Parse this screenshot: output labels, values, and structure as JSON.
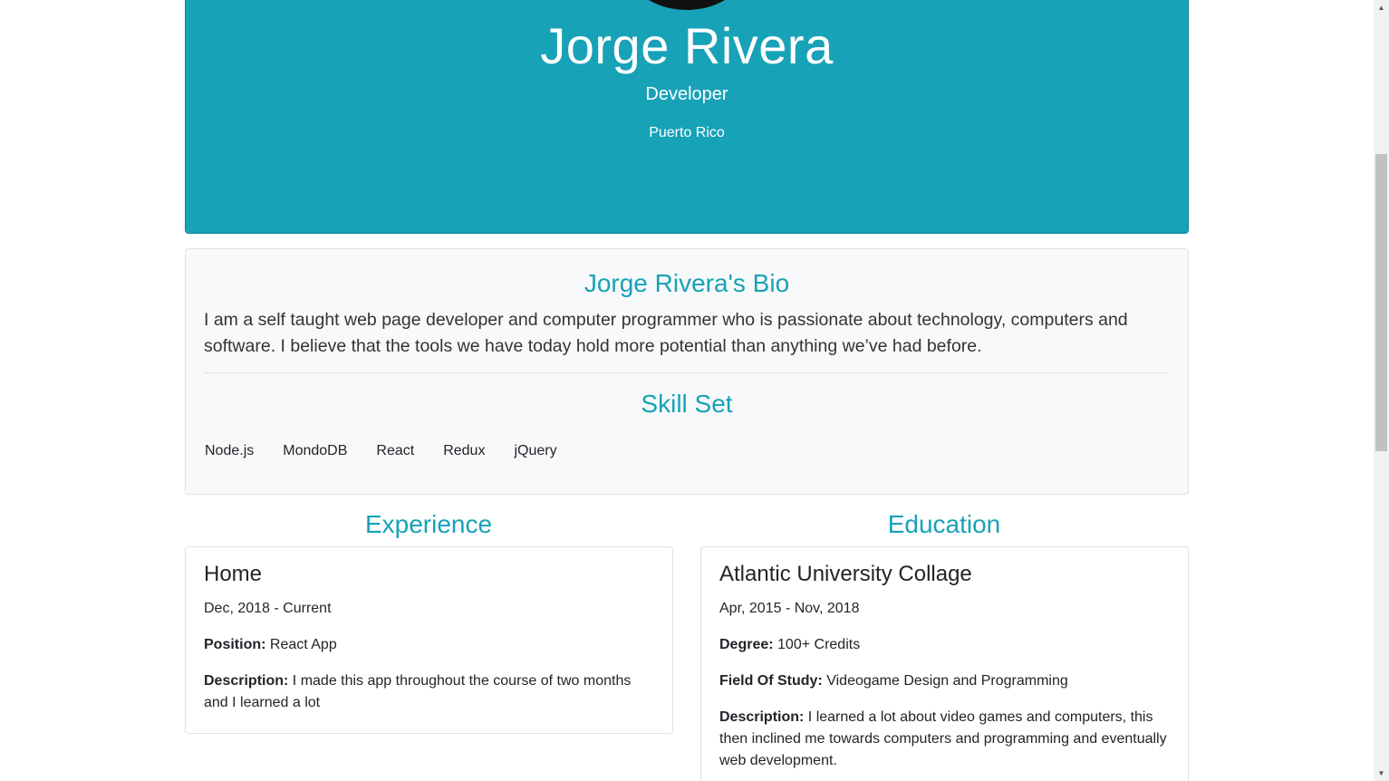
{
  "header": {
    "name": "Jorge Rivera",
    "role": "Developer",
    "location": "Puerto Rico",
    "bg_color": "#17a2b8"
  },
  "bio": {
    "title": "Jorge Rivera's Bio",
    "text": "I am a self taught web page developer and computer programmer who is passionate about technology, computers and software. I believe that the tools we have today hold more potential than anything we’ve had before."
  },
  "skills": {
    "title": "Skill Set",
    "items": [
      "Node.js",
      "MondoDB",
      "React",
      "Redux",
      "jQuery"
    ]
  },
  "experience": {
    "title": "Experience",
    "entries": [
      {
        "name": "Home",
        "dates": "Dec, 2018 - Current",
        "position_label": "Position:",
        "position": "React App",
        "description_label": "Description:",
        "description": "I made this app throughout the course of two months and I learned a lot"
      }
    ]
  },
  "education": {
    "title": "Education",
    "entries": [
      {
        "school": "Atlantic University Collage",
        "dates": "Apr, 2015 - Nov, 2018",
        "degree_label": "Degree:",
        "degree": "100+ Credits",
        "field_label": "Field Of Study:",
        "field": "Videogame Design and Programming",
        "description_label": "Description:",
        "description": "I learned a lot about video games and computers, this then inclined me towards computers and programming and eventually web development."
      }
    ]
  },
  "scrollbar": {
    "up_icon": "triangle-up",
    "down_icon": "triangle-down"
  }
}
